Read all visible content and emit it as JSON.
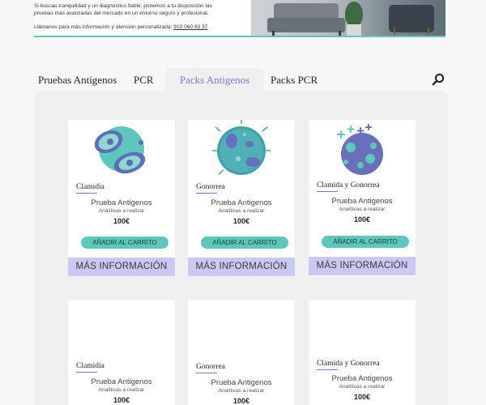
{
  "banner": {
    "text_line1": "Si buscas tranquilidad y un diagnóstico fiable, ponemos a tu disposición las",
    "text_line2": "pruebas más avanzadas del mercado en un entorno seguro y profesional.",
    "call_text": "Llámanos para más información y atención personalizada:",
    "phone": "910 060 83 37"
  },
  "tabs": [
    {
      "label": "Pruebas Antígenos"
    },
    {
      "label": "PCR"
    },
    {
      "label": "Packs Antigenos",
      "active": true
    },
    {
      "label": "Packs PCR"
    }
  ],
  "icons": {
    "search": "search-icon"
  },
  "colors": {
    "accent_teal": "#5ec7bd",
    "accent_purple": "#7779c6",
    "info_button": "#c8c9f5"
  },
  "cards": [
    {
      "name": "Clamidia",
      "type": "Prueba Antigenos",
      "sub": "Analíticas a realizar",
      "price": "100€",
      "cart": "AÑADIR AL CARRITO",
      "info": "MÁS INFORMACIÓN"
    },
    {
      "name": "Gonorrea",
      "type": "Prueba Antigenos",
      "sub": "Analíticas a realizar",
      "price": "100€",
      "cart": "AÑADIR AL CARRITO",
      "info": "MÁS INFORMACIÓN"
    },
    {
      "name": "Clamida y Gonorrea",
      "type": "Prueba Antigenos",
      "sub": "Analíticas a realizar",
      "price": "100€",
      "cart": "AÑADIR AL CARRITO",
      "info": "MÁS INFORMACIÓN"
    },
    {
      "name": "Clamidia",
      "type": "Prueba Antigenos",
      "sub": "Analíticas a realizar",
      "price": "100€"
    },
    {
      "name": "Gonorrea",
      "type": "Prueba Antigenos",
      "sub": "Analíticas a realizar",
      "price": "100€"
    },
    {
      "name": "Clamida y Gonorrea",
      "type": "Prueba Antigenos",
      "sub": "Analíticas a realizar",
      "price": "100€"
    }
  ]
}
